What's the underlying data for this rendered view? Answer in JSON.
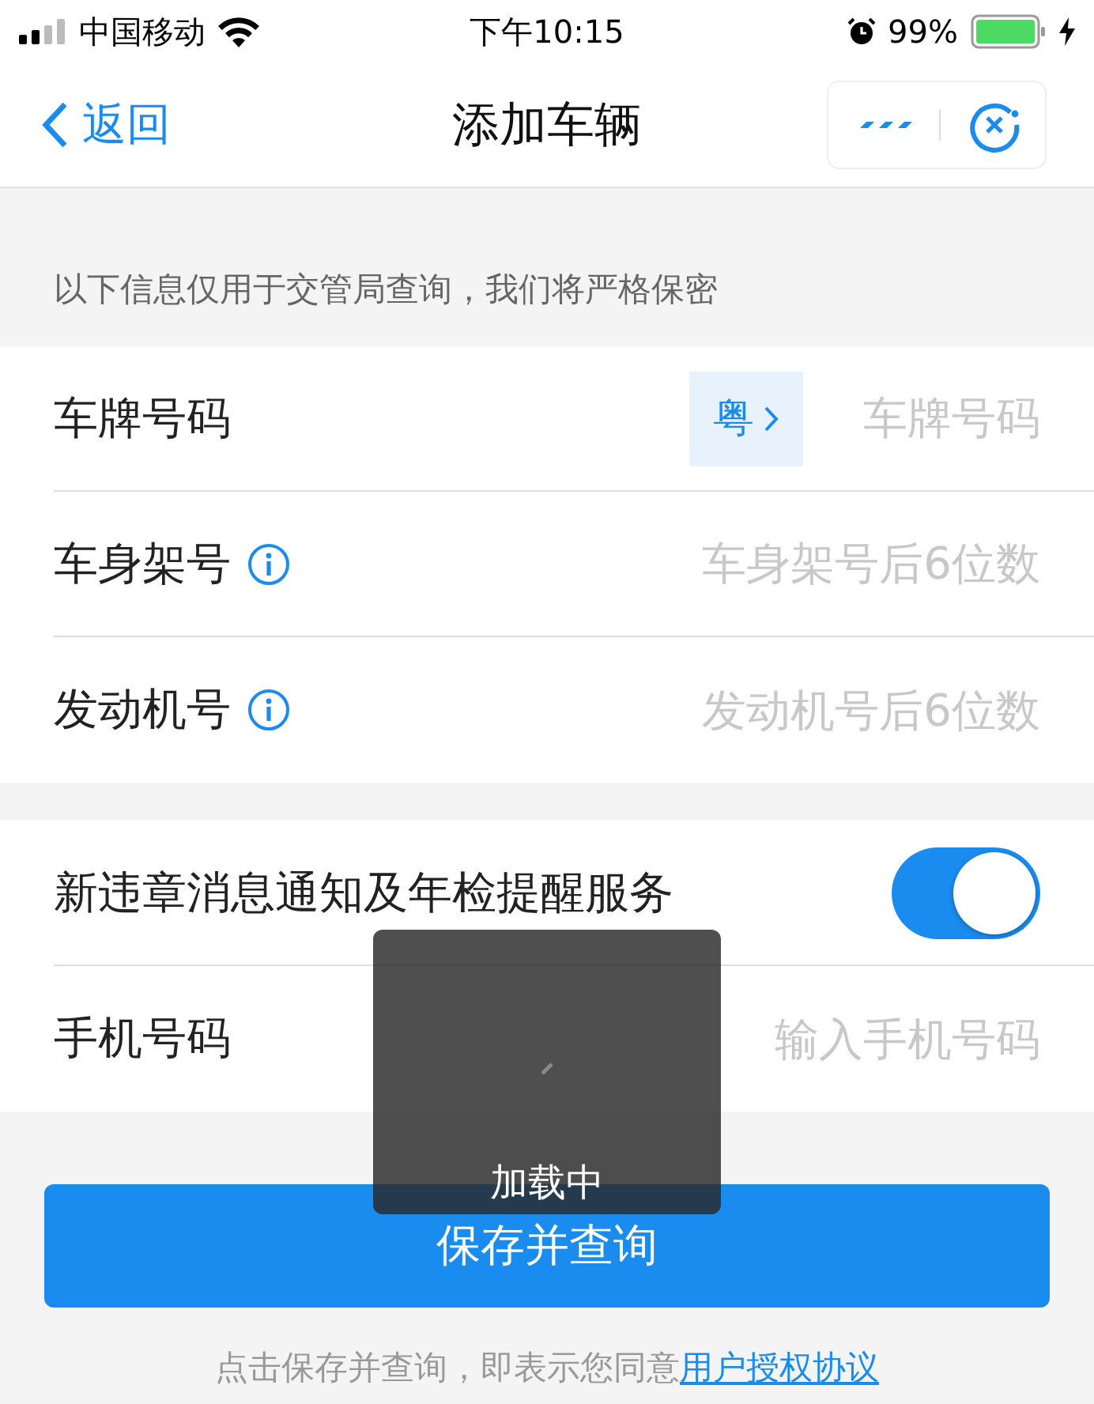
{
  "status_bar": {
    "carrier": "中国移动",
    "time": "下午10:15",
    "battery": "99%"
  },
  "nav": {
    "back": "返回",
    "title": "添加车辆"
  },
  "notice": "以下信息仅用于交管局查询，我们将严格保密",
  "vehicle_fields": [
    {
      "kind": "plate",
      "label": "车牌号码",
      "province": "粤",
      "placeholder": "车牌号码"
    },
    {
      "kind": "info",
      "label": "车身架号",
      "placeholder": "车身架号后6位数"
    },
    {
      "kind": "info",
      "label": "发动机号",
      "placeholder": "发动机号后6位数"
    }
  ],
  "service": {
    "label": "新违章消息通知及年检提醒服务",
    "on": true
  },
  "phone": {
    "label": "手机号码",
    "placeholder": "输入手机号码"
  },
  "submit": "保存并查询",
  "agreement": {
    "text": "点击保存并查询，即表示您同意",
    "link": "用户授权协议"
  },
  "toast": {
    "text": "加载中"
  }
}
